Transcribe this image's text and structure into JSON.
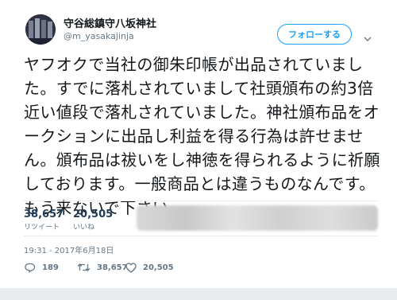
{
  "user": {
    "name": "守谷総鎮守八坂神社",
    "handle": "@m_yasakajinja"
  },
  "follow_button": {
    "label": "フォローする"
  },
  "tweet": {
    "text": "ヤフオクで当社の御朱印帳が出品されていました。すでに落札されていまして社頭頒布の約3倍近い値段で落札されていました。神社頒布品をオークションに出品し利益を得る行為は許せません。頒布品は祓いをし神徳を得られるように祈願しております。一般商品とは違うものなんです。もう来ないで下さい。",
    "timestamp": "19:31 - 2017年6月18日"
  },
  "stats": {
    "retweets": {
      "count": "38,657",
      "label": "リツイート"
    },
    "likes": {
      "count": "20,505",
      "label": "いいね"
    }
  },
  "actions": {
    "reply_count": "189",
    "retweet_count": "38,657",
    "like_count": "20,505"
  },
  "colors": {
    "accent": "#1da1f2",
    "stat_number": "#1e3a56",
    "muted": "#657786",
    "divider": "#e6ecf0"
  }
}
